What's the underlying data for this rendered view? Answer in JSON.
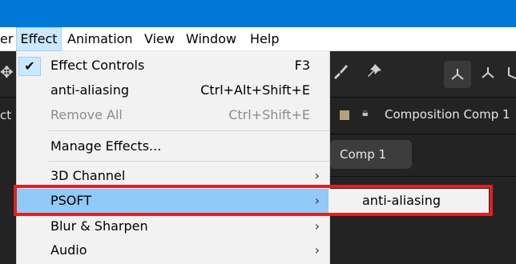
{
  "menubar": {
    "items": [
      {
        "label": "er"
      },
      {
        "label": "Effect"
      },
      {
        "label": "Animation"
      },
      {
        "label": "View"
      },
      {
        "label": "Window"
      },
      {
        "label": "Help"
      }
    ]
  },
  "panel": {
    "left_label": "ct",
    "composition_title": "Composition Comp 1",
    "comp_tab": "Comp 1"
  },
  "effect_menu": {
    "items": [
      {
        "label": "Effect Controls",
        "shortcut": "F3",
        "checked": "✔"
      },
      {
        "label": "anti-aliasing",
        "shortcut": "Ctrl+Alt+Shift+E"
      },
      {
        "label": "Remove All",
        "shortcut": "Ctrl+Shift+E"
      },
      {
        "label": "Manage Effects..."
      },
      {
        "label": "3D Channel",
        "arrow": "›"
      },
      {
        "label": "PSOFT",
        "arrow": "›"
      },
      {
        "label": "Blur & Sharpen",
        "arrow": "›"
      },
      {
        "label": "Audio",
        "arrow": "›"
      }
    ]
  },
  "submenu": {
    "items": [
      {
        "label": "anti-aliasing"
      }
    ]
  },
  "colors": {
    "titlebar": "#0078d7",
    "highlight": "#91c9f7",
    "annotation": "#e02020"
  }
}
